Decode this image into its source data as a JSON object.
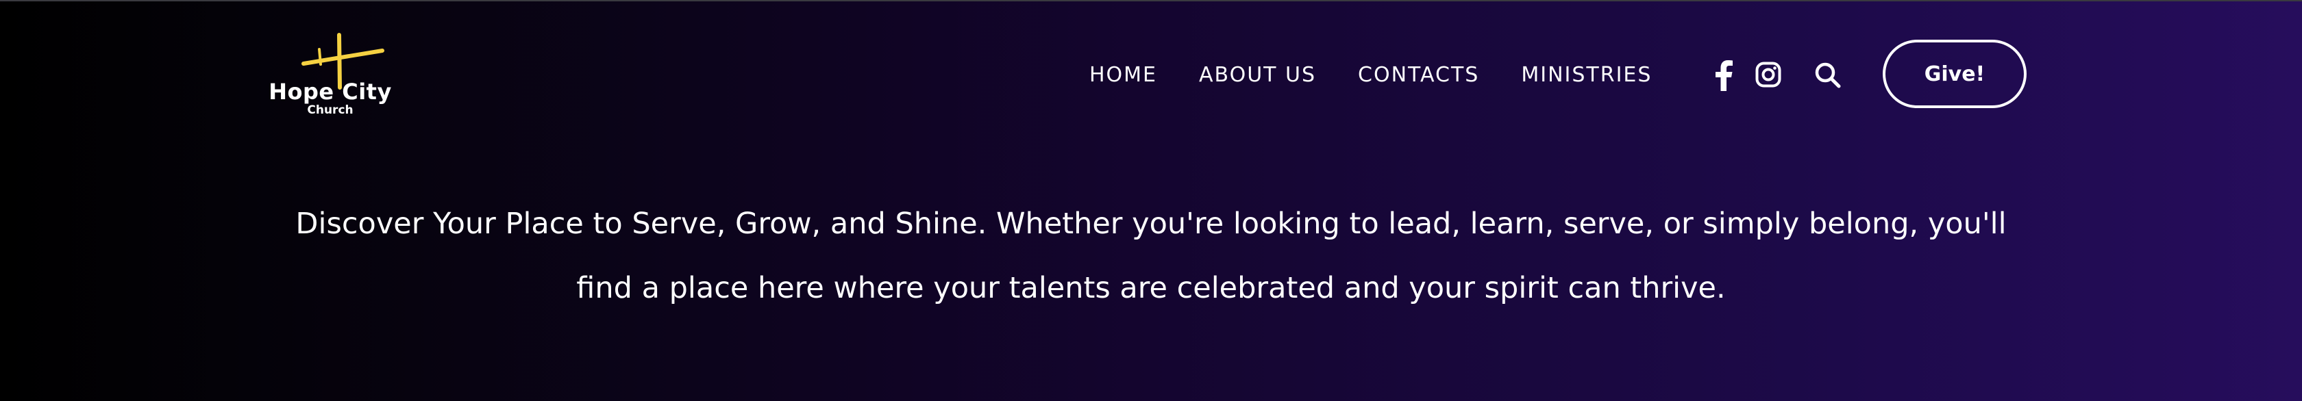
{
  "brand": {
    "name": "Hope City",
    "subtitle": "Church",
    "accent_color": "#f5d142"
  },
  "nav": {
    "items": [
      {
        "label": "HOME"
      },
      {
        "label": "ABOUT US"
      },
      {
        "label": "CONTACTS"
      },
      {
        "label": "MINISTRIES"
      }
    ]
  },
  "social": {
    "icons": [
      "facebook-icon",
      "instagram-icon",
      "search-icon"
    ]
  },
  "cta": {
    "give_label": "Give!"
  },
  "hero": {
    "line1": "Discover Your Place to Serve, Grow, and Shine. Whether you're looking to lead, learn, serve, or simply belong, you'll",
    "line2": "find a place here where your talents are celebrated and your spirit can thrive."
  },
  "colors": {
    "background_start": "#000000",
    "background_end": "#260d5c",
    "text": "#ffffff"
  }
}
